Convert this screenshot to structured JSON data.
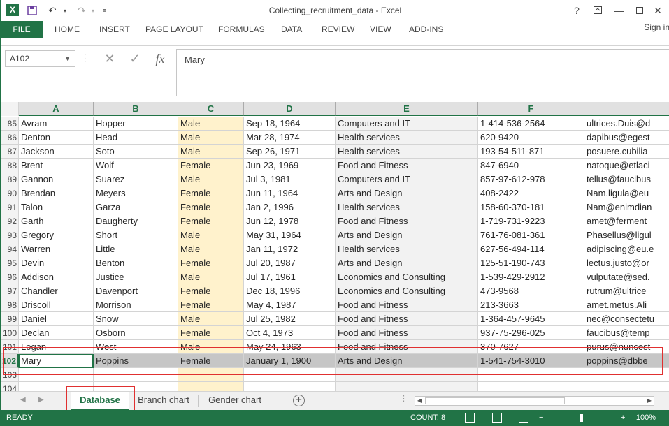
{
  "window": {
    "title": "Collecting_recruitment_data - Excel",
    "help": "?",
    "minimize": "—",
    "close": "✕"
  },
  "ribbon": {
    "file": "FILE",
    "tabs": [
      "HOME",
      "INSERT",
      "PAGE LAYOUT",
      "FORMULAS",
      "DATA",
      "REVIEW",
      "VIEW",
      "ADD-INS"
    ],
    "signin": "Sign in"
  },
  "formula_bar": {
    "name_box": "A102",
    "cancel": "✕",
    "enter": "✓",
    "fx": "fx",
    "value": "Mary"
  },
  "columns": [
    "A",
    "B",
    "C",
    "D",
    "E",
    "F"
  ],
  "rows": [
    {
      "num": "85",
      "a": "Avram",
      "b": "Hopper",
      "c": "Male",
      "d": "Sep 18, 1964",
      "e": "Computers and IT",
      "f": "1-414-536-2564",
      "g": "ultrices.Duis@d"
    },
    {
      "num": "86",
      "a": "Denton",
      "b": "Head",
      "c": "Male",
      "d": "Mar 28, 1974",
      "e": "Health services",
      "f": "620-9420",
      "g": "dapibus@egest"
    },
    {
      "num": "87",
      "a": "Jackson",
      "b": "Soto",
      "c": "Male",
      "d": "Sep 26, 1971",
      "e": "Health services",
      "f": "193-54-511-871",
      "g": "posuere.cubilia"
    },
    {
      "num": "88",
      "a": "Brent",
      "b": "Wolf",
      "c": "Female",
      "d": "Jun 23, 1969",
      "e": "Food and Fitness",
      "f": "847-6940",
      "g": "natoque@etlaci"
    },
    {
      "num": "89",
      "a": "Gannon",
      "b": "Suarez",
      "c": "Male",
      "d": "Jul 3, 1981",
      "e": "Computers and IT",
      "f": "857-97-612-978",
      "g": "tellus@faucibus"
    },
    {
      "num": "90",
      "a": "Brendan",
      "b": "Meyers",
      "c": "Female",
      "d": "Jun 11, 1964",
      "e": "Arts and Design",
      "f": "408-2422",
      "g": "Nam.ligula@eu"
    },
    {
      "num": "91",
      "a": "Talon",
      "b": "Garza",
      "c": "Female",
      "d": "Jan 2, 1996",
      "e": "Health services",
      "f": "158-60-370-181",
      "g": "Nam@enimdian"
    },
    {
      "num": "92",
      "a": "Garth",
      "b": "Daugherty",
      "c": "Female",
      "d": "Jun 12, 1978",
      "e": "Food and Fitness",
      "f": "1-719-731-9223",
      "g": "amet@ferment"
    },
    {
      "num": "93",
      "a": "Gregory",
      "b": "Short",
      "c": "Male",
      "d": "May 31, 1964",
      "e": "Arts and Design",
      "f": "761-76-081-361",
      "g": "Phasellus@ligul"
    },
    {
      "num": "94",
      "a": "Warren",
      "b": "Little",
      "c": "Male",
      "d": "Jan 11, 1972",
      "e": "Health services",
      "f": "627-56-494-114",
      "g": "adipiscing@eu.e"
    },
    {
      "num": "95",
      "a": "Devin",
      "b": "Benton",
      "c": "Female",
      "d": "Jul 20, 1987",
      "e": "Arts and Design",
      "f": "125-51-190-743",
      "g": "lectus.justo@or"
    },
    {
      "num": "96",
      "a": "Addison",
      "b": "Justice",
      "c": "Male",
      "d": "Jul 17, 1961",
      "e": "Economics and Consulting",
      "f": "1-539-429-2912",
      "g": "vulputate@sed."
    },
    {
      "num": "97",
      "a": "Chandler",
      "b": "Davenport",
      "c": "Female",
      "d": "Dec 18, 1996",
      "e": "Economics and Consulting",
      "f": "473-9568",
      "g": "rutrum@ultrice"
    },
    {
      "num": "98",
      "a": "Driscoll",
      "b": "Morrison",
      "c": "Female",
      "d": "May 4, 1987",
      "e": "Food and Fitness",
      "f": "213-3663",
      "g": "amet.metus.Ali"
    },
    {
      "num": "99",
      "a": "Daniel",
      "b": "Snow",
      "c": "Male",
      "d": "Jul 25, 1982",
      "e": "Food and Fitness",
      "f": "1-364-457-9645",
      "g": "nec@consectetu"
    },
    {
      "num": "100",
      "a": "Declan",
      "b": "Osborn",
      "c": "Female",
      "d": "Oct 4, 1973",
      "e": "Food and Fitness",
      "f": "937-75-296-025",
      "g": "faucibus@temp"
    },
    {
      "num": "101",
      "a": "Logan",
      "b": "West",
      "c": "Male",
      "d": "May 24, 1963",
      "e": "Food and Fitness",
      "f": "370-7627",
      "g": "purus@nuncest"
    },
    {
      "num": "102",
      "a": "Mary",
      "b": "Poppins",
      "c": "Female",
      "d": "January 1, 1900",
      "e": "Arts and Design",
      "f": "1-541-754-3010",
      "g": "poppins@dbbe"
    },
    {
      "num": "103",
      "a": "",
      "b": "",
      "c": "",
      "d": "",
      "e": "",
      "f": "",
      "g": ""
    },
    {
      "num": "104",
      "a": "",
      "b": "",
      "c": "",
      "d": "",
      "e": "",
      "f": "",
      "g": ""
    }
  ],
  "sheets": [
    "Database",
    "Branch chart",
    "Gender chart"
  ],
  "status": {
    "ready": "READY",
    "count": "COUNT: 8",
    "zoom": "100%",
    "zoom_minus": "−",
    "zoom_plus": "+"
  },
  "colors": {
    "accent": "#217346",
    "gender_column": "#fff2cc",
    "selection": "#c6c6c6",
    "highlight_box": "#e03030"
  }
}
